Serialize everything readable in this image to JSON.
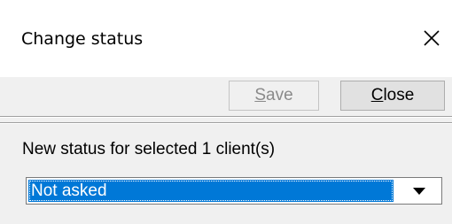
{
  "window": {
    "title": "Change status"
  },
  "toolbar": {
    "save_prefix": "",
    "save_mnemonic": "S",
    "save_rest": "ave",
    "close_mnemonic": "C",
    "close_rest": "lose"
  },
  "form": {
    "prompt": "New status for selected 1 client(s)",
    "status_select": {
      "selected_value": "Not asked"
    }
  },
  "colors": {
    "selection_bg": "#0078d7",
    "disabled_text": "#8a8a8a"
  },
  "icons": {
    "close": "close-icon",
    "dropdown": "chevron-down-icon"
  }
}
